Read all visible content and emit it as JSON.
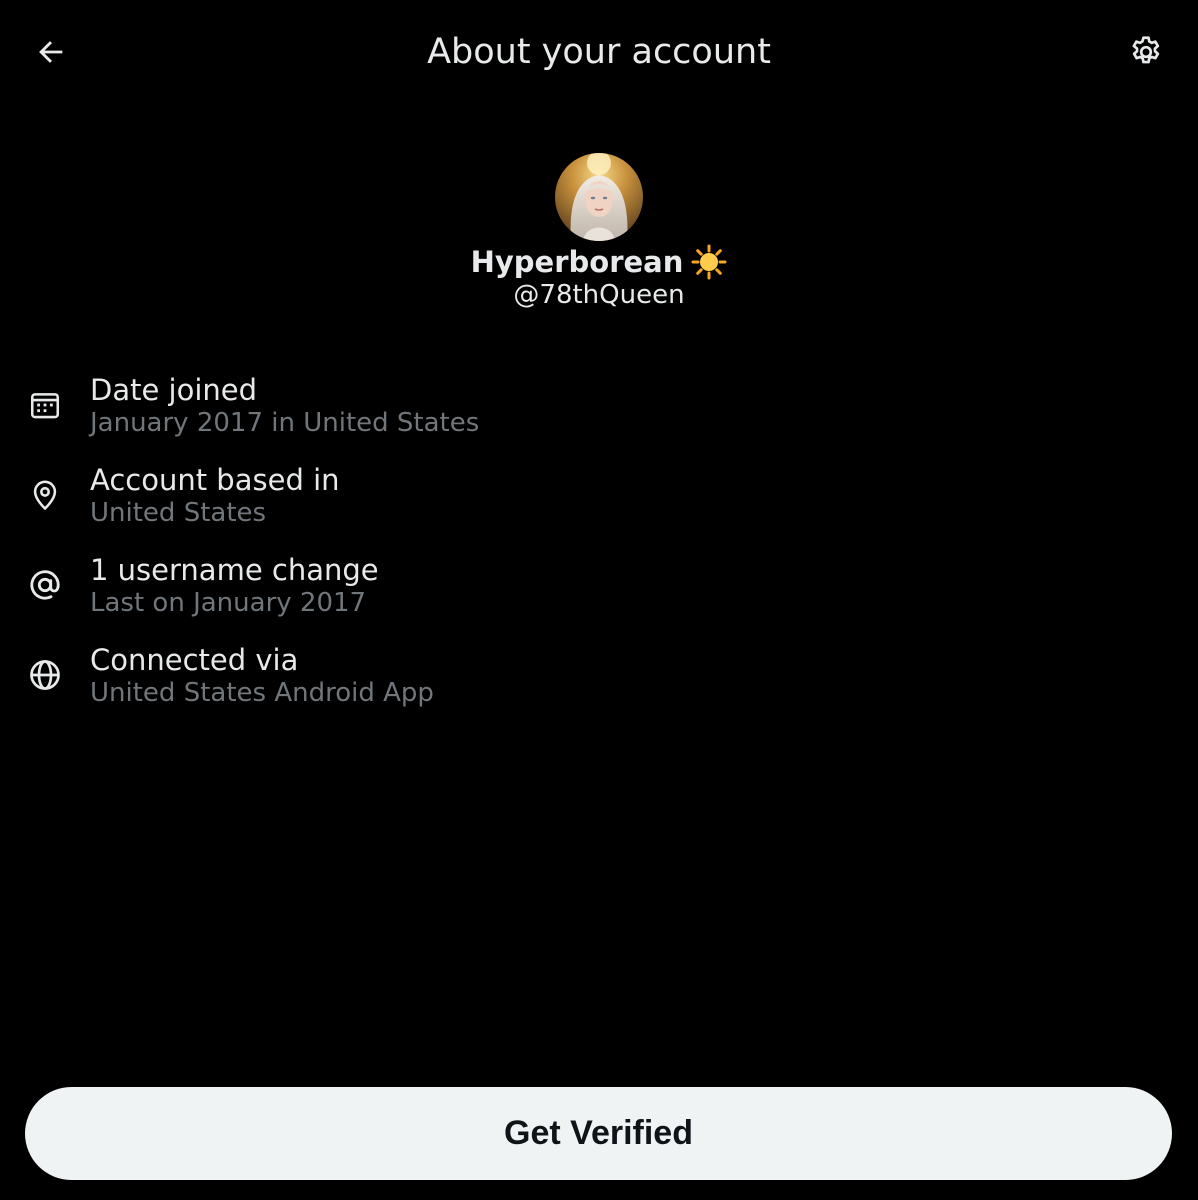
{
  "header": {
    "title": "About your account",
    "back_icon": "arrow-left-icon",
    "settings_icon": "gear-icon"
  },
  "profile": {
    "display_name": "Hyperborean",
    "name_emoji": "sun-emoji-icon",
    "handle": "@78thQueen",
    "avatar": "profile-avatar"
  },
  "info": [
    {
      "icon": "calendar-icon",
      "title": "Date joined",
      "subtitle": "January 2017 in United States"
    },
    {
      "icon": "location-pin-icon",
      "title": "Account based in",
      "subtitle": "United States"
    },
    {
      "icon": "at-sign-icon",
      "title": "1 username change",
      "subtitle": "Last on January 2017"
    },
    {
      "icon": "globe-icon",
      "title": "Connected via",
      "subtitle": "United States Android App"
    }
  ],
  "cta": {
    "label": "Get Verified"
  },
  "colors": {
    "background": "#000000",
    "primary_text": "#e7e9ea",
    "secondary_text": "#71767b",
    "button_bg": "#eff3f4",
    "button_text": "#0f1419"
  }
}
